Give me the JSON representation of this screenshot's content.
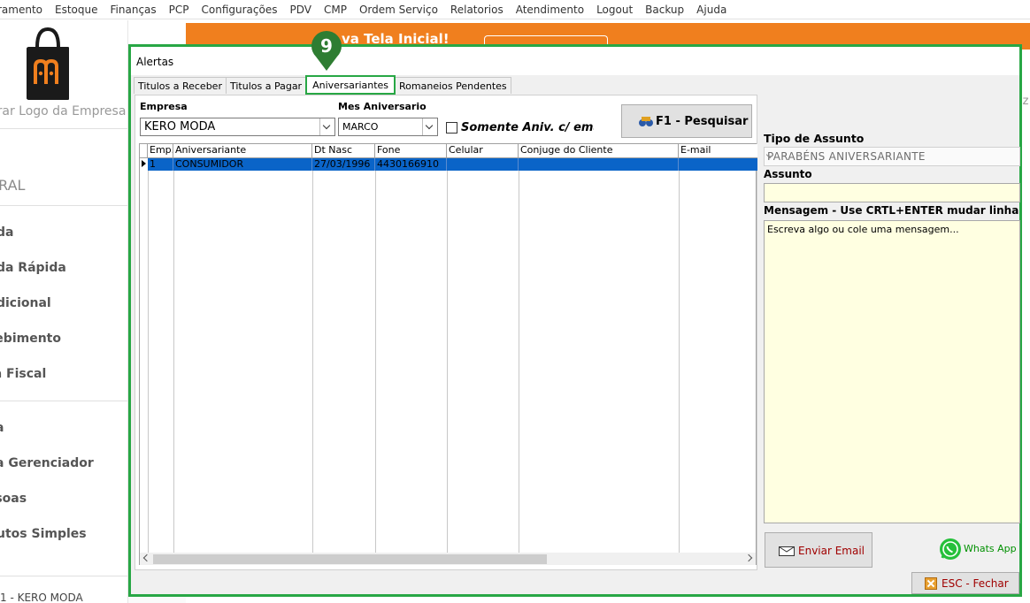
{
  "menu": {
    "items": [
      "ramento",
      "Estoque",
      "Finanças",
      "PCP",
      "Configurações",
      "PDV",
      "CMP",
      "Ordem Serviço",
      "Relatorios",
      "Atendimento",
      "Logout",
      "Backup",
      "Ajuda"
    ]
  },
  "sidebar": {
    "logo_caption": "erar Logo da Empresa",
    "section": "ERAL",
    "items": [
      "nda",
      "nda Rápida",
      "ndicional",
      "cebimento",
      "ta Fiscal",
      "xa",
      "xa Gerenciador",
      "ssoas",
      "dutos Simples"
    ],
    "footer": "1 - KERO MODA"
  },
  "banner": {
    "text": "va Tela Inicial!"
  },
  "bg_fragment": "iz",
  "window": {
    "title": "Alertas",
    "tabs": [
      "Titulos a Receber",
      "Titulos a Pagar",
      "Aniversariantes",
      "Romaneios Pendentes"
    ],
    "active_tab": 2,
    "step_marker": "9",
    "form": {
      "empresa_label": "Empresa",
      "empresa_value": "KERO MODA",
      "mes_label": "Mes Aniversario",
      "mes_value": "MARCO",
      "only_email_label": "Somente Aniv. c/ email",
      "search_button": "F1 - Pesquisar"
    },
    "grid": {
      "columns": [
        "Emp.",
        "Aniversariante",
        "Dt Nasc",
        "Fone",
        "Celular",
        "Conjuge do Cliente",
        "E-mail"
      ],
      "rows": [
        [
          "1",
          "CONSUMIDOR",
          "27/03/1996",
          "4430166910",
          "",
          "",
          ""
        ]
      ]
    },
    "right": {
      "tipo_label": "Tipo de Assunto",
      "tipo_value": "PARABÉNS ANIVERSARIANTE",
      "assunto_label": "Assunto",
      "assunto_value": "",
      "mensagem_label": "Mensagem - Use CRTL+ENTER mudar linha",
      "mensagem_placeholder": "Escreva algo ou cole uma mensagem...",
      "email_button": "Enviar Email",
      "whatsapp_button": "Whats App"
    },
    "close_button": "ESC - Fechar"
  },
  "colors": {
    "highlight": "#28a745",
    "banner": "#f07f1e",
    "selection": "#0a64c8",
    "note_bg": "#ffffe1"
  }
}
